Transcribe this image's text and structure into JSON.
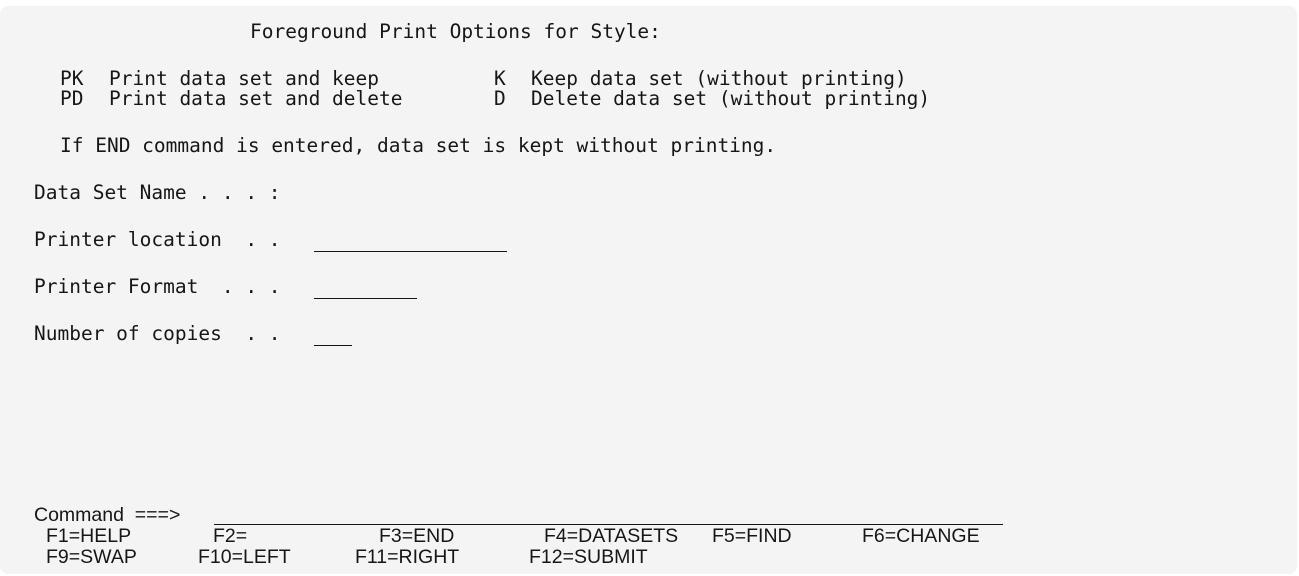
{
  "title": "Foreground Print Options for Style:",
  "options": [
    {
      "code": "PK",
      "desc": "Print data set and keep"
    },
    {
      "code": "PD",
      "desc": "Print data set and delete"
    },
    {
      "code": "K",
      "desc": "Keep data set (without printing)"
    },
    {
      "code": "D",
      "desc": "Delete data set (without printing)"
    }
  ],
  "note": "If END command is entered, data set is kept without printing.",
  "fields": {
    "data_set_name": {
      "label": "Data Set Name . . . :",
      "value": ""
    },
    "printer_location": {
      "label": "Printer location  . .",
      "value": ""
    },
    "printer_format": {
      "label": "Printer Format  . . .",
      "value": ""
    },
    "number_of_copies": {
      "label": "Number of copies  . .",
      "value": ""
    }
  },
  "command": {
    "label": "Command  ===>",
    "value": ""
  },
  "fkeys": {
    "f1": "F1=HELP",
    "f2": "F2=",
    "f3": "F3=END",
    "f4": "F4=DATASETS",
    "f5": "F5=FIND",
    "f6": "F6=CHANGE",
    "f9": "F9=SWAP",
    "f10": "F10=LEFT",
    "f11": "F11=RIGHT",
    "f12": "F12=SUBMIT"
  }
}
